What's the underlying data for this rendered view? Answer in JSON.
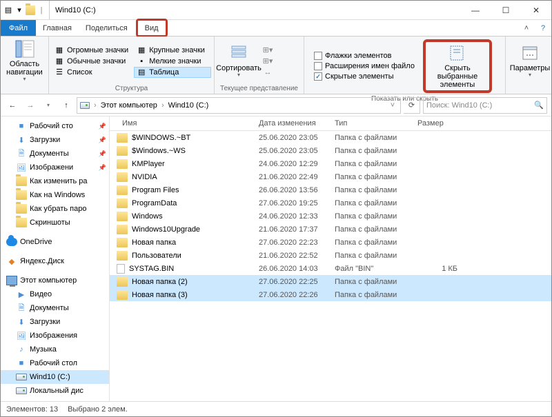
{
  "window": {
    "title": "Wind10 (C:)"
  },
  "tabs": {
    "file": "Файл",
    "home": "Главная",
    "share": "Поделиться",
    "view": "Вид"
  },
  "ribbon": {
    "nav_pane": "Область навигации",
    "layout": {
      "huge": "Огромные значки",
      "large": "Крупные значки",
      "normal": "Обычные значки",
      "small": "Мелкие значки",
      "list": "Список",
      "table": "Таблица"
    },
    "group_layout": "Структура",
    "sort": "Сортировать",
    "group_view": "Текущее представление",
    "checks": {
      "flags": "Флажки элементов",
      "ext": "Расширения имен файло",
      "hidden": "Скрытые элементы"
    },
    "hide": "Скрыть выбранные элементы",
    "group_show": "Показать или скрыть",
    "options": "Параметры"
  },
  "crumbs": {
    "pc": "Этот компьютер",
    "drive": "Wind10 (C:)"
  },
  "search_placeholder": "Поиск: Wind10 (C:)",
  "columns": {
    "name": "Имя",
    "date": "Дата изменения",
    "type": "Тип",
    "size": "Размер"
  },
  "tree": {
    "desktop": "Рабочий сто",
    "downloads": "Загрузки",
    "documents": "Документы",
    "pictures": "Изображени",
    "q1": "Как изменить ра",
    "q2": "Как на Windows",
    "q3": "Как убрать паро",
    "shots": "Скриншоты",
    "onedrive": "OneDrive",
    "yadisk": "Яндекс.Диск",
    "thispc": "Этот компьютер",
    "video": "Видео",
    "docs2": "Документы",
    "dl2": "Загрузки",
    "pics2": "Изображения",
    "music": "Музыка",
    "desk2": "Рабочий стол",
    "drive": "Wind10 (C:)",
    "localdisk": "Локальный дис"
  },
  "files": [
    {
      "name": "$WINDOWS.~BT",
      "date": "25.06.2020 23:05",
      "type": "Папка с файлами",
      "size": "",
      "icon": "folder",
      "sel": false
    },
    {
      "name": "$Windows.~WS",
      "date": "25.06.2020 23:05",
      "type": "Папка с файлами",
      "size": "",
      "icon": "folder",
      "sel": false
    },
    {
      "name": "KMPlayer",
      "date": "24.06.2020 12:29",
      "type": "Папка с файлами",
      "size": "",
      "icon": "folder",
      "sel": false
    },
    {
      "name": "NVIDIA",
      "date": "21.06.2020 22:49",
      "type": "Папка с файлами",
      "size": "",
      "icon": "folder",
      "sel": false
    },
    {
      "name": "Program Files",
      "date": "26.06.2020 13:56",
      "type": "Папка с файлами",
      "size": "",
      "icon": "folder",
      "sel": false
    },
    {
      "name": "ProgramData",
      "date": "27.06.2020 19:25",
      "type": "Папка с файлами",
      "size": "",
      "icon": "folder",
      "sel": false
    },
    {
      "name": "Windows",
      "date": "24.06.2020 12:33",
      "type": "Папка с файлами",
      "size": "",
      "icon": "folder",
      "sel": false
    },
    {
      "name": "Windows10Upgrade",
      "date": "21.06.2020 17:37",
      "type": "Папка с файлами",
      "size": "",
      "icon": "folder",
      "sel": false
    },
    {
      "name": "Новая папка",
      "date": "27.06.2020 22:23",
      "type": "Папка с файлами",
      "size": "",
      "icon": "folder",
      "sel": false
    },
    {
      "name": "Пользователи",
      "date": "21.06.2020 22:52",
      "type": "Папка с файлами",
      "size": "",
      "icon": "folder",
      "sel": false
    },
    {
      "name": "SYSTAG.BIN",
      "date": "26.06.2020 14:03",
      "type": "Файл \"BIN\"",
      "size": "1 КБ",
      "icon": "file",
      "sel": false
    },
    {
      "name": "Новая папка (2)",
      "date": "27.06.2020 22:25",
      "type": "Папка с файлами",
      "size": "",
      "icon": "folder",
      "sel": true
    },
    {
      "name": "Новая папка (3)",
      "date": "27.06.2020 22:26",
      "type": "Папка с файлами",
      "size": "",
      "icon": "folder",
      "sel": true
    }
  ],
  "status": {
    "count": "Элементов: 13",
    "selected": "Выбрано 2 элем."
  }
}
